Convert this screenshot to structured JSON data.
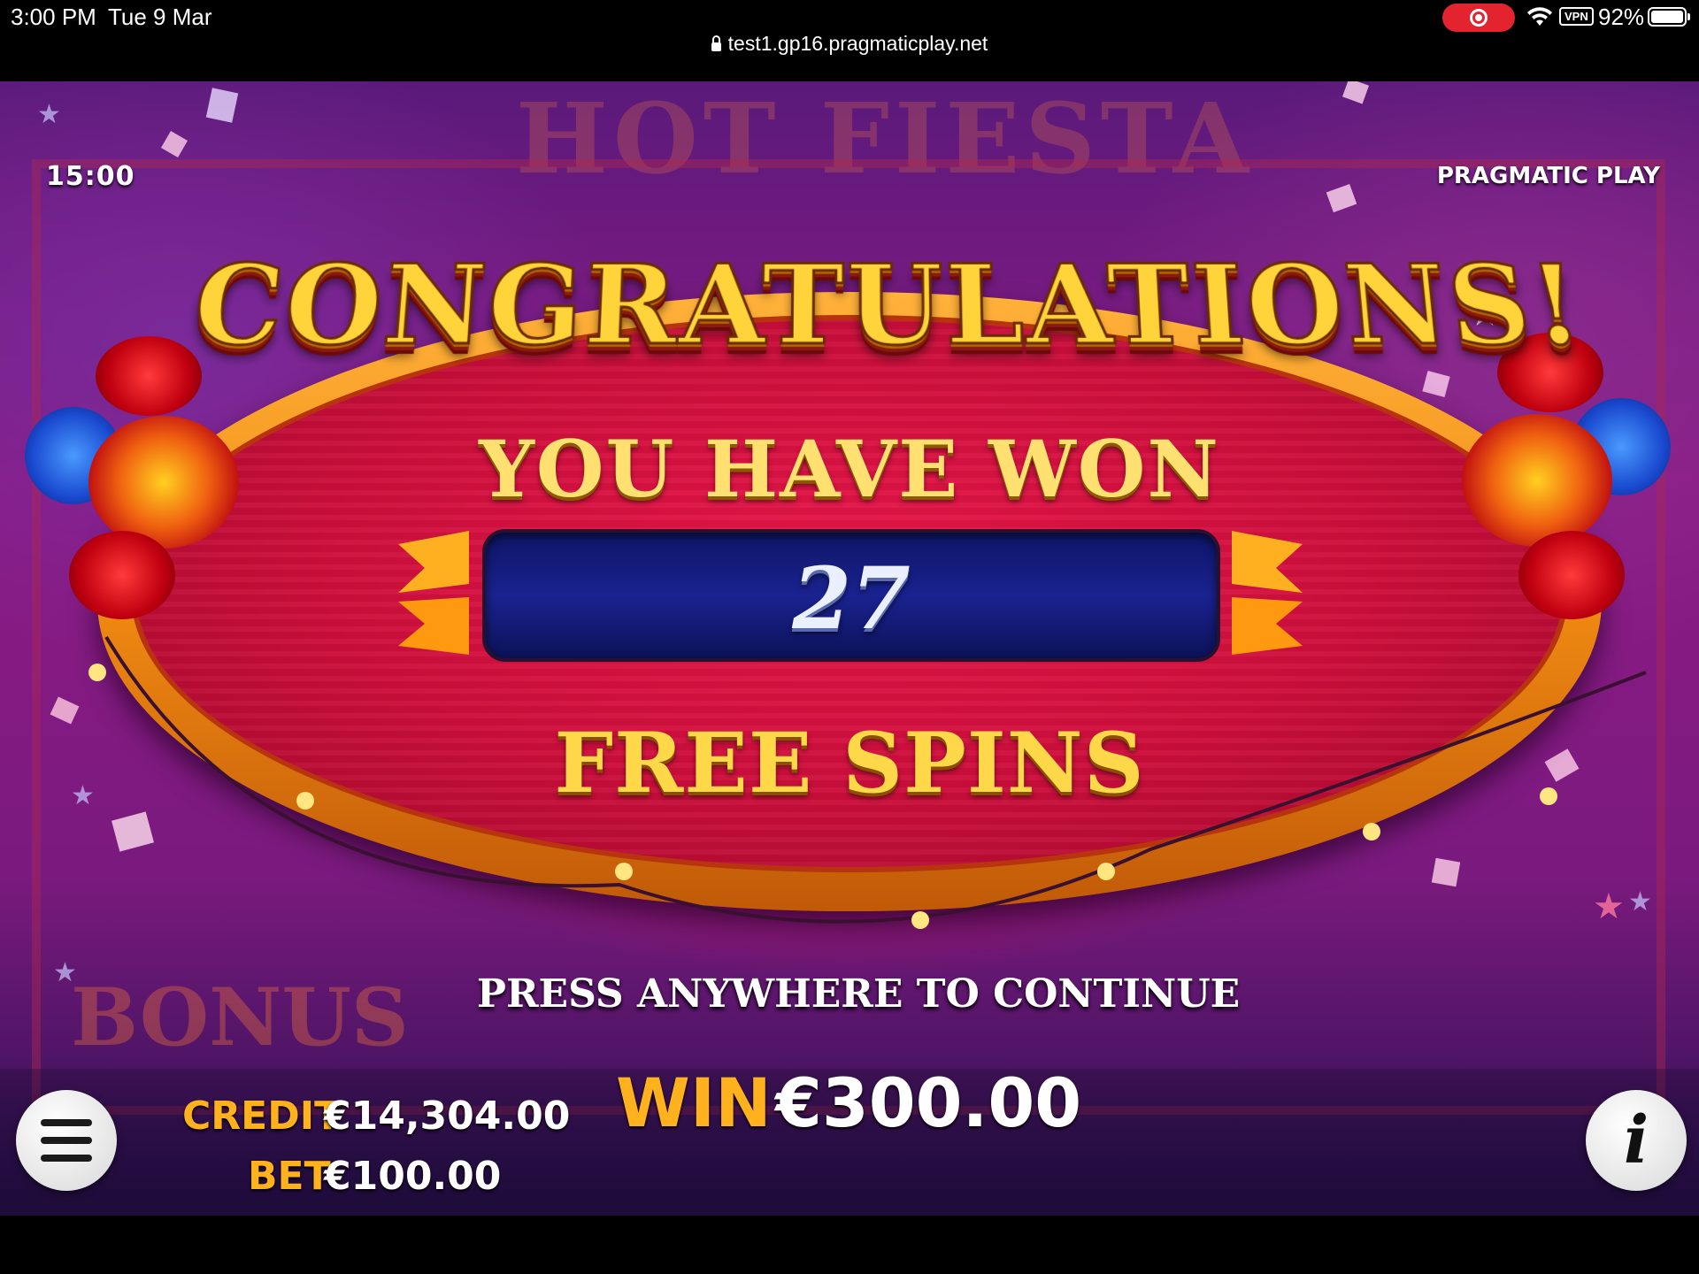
{
  "status_bar": {
    "time": "3:00 PM",
    "date": "Tue 9 Mar",
    "url": "test1.gp16.pragmaticplay.net",
    "vpn_label": "VPN",
    "battery": "92%"
  },
  "game": {
    "clock": "15:00",
    "brand": "PRAGMATIC PLAY",
    "background_title": "HOT FIESTA",
    "background_bonus": "BONUS"
  },
  "popup": {
    "title": "CONGRATULATIONS!",
    "subtitle": "YOU HAVE WON",
    "count": "27",
    "label": "FREE SPINS",
    "prompt": "PRESS ANYWHERE TO CONTINUE"
  },
  "hud": {
    "credit_label": "CREDIT",
    "credit_value": "€14,304.00",
    "bet_label": "BET",
    "bet_value": "€100.00",
    "win_label": "WIN",
    "win_value": "€300.00"
  },
  "colors": {
    "accent_gold": "#ffb21e",
    "plaque_red": "#cf0f3c",
    "count_box_blue": "#1a2290"
  }
}
